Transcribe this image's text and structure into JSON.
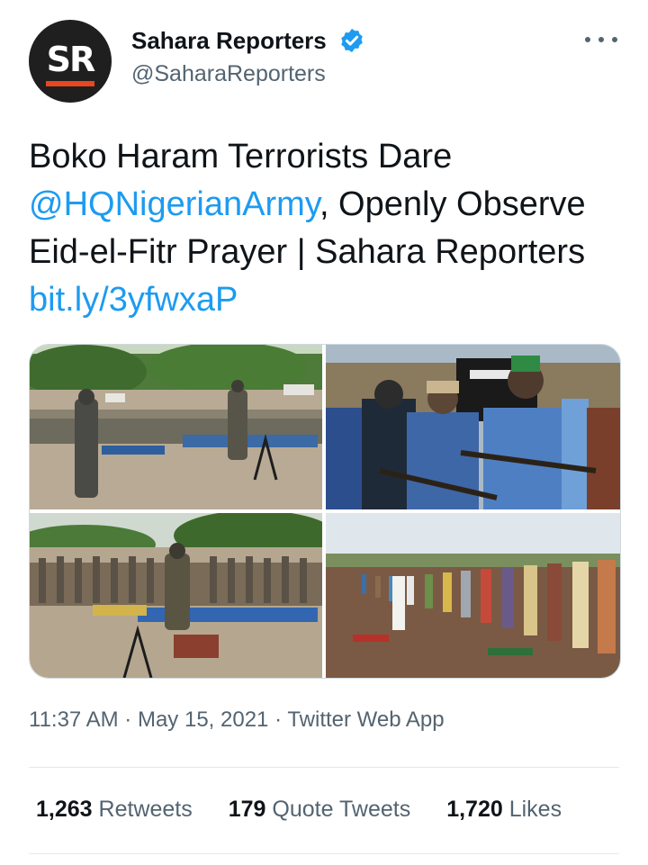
{
  "account": {
    "name": "Sahara Reporters",
    "handle": "@SaharaReporters",
    "avatar_text": "SR",
    "verified": true
  },
  "icons": {
    "verified": "verified-badge-icon",
    "more": "more-options-icon"
  },
  "tweet": {
    "text_part1": "Boko Haram Terrorists Dare ",
    "mention": "@HQNigerianArmy",
    "text_part2": ", Openly Observe Eid-el-Fitr Prayer | Sahara Reporters ",
    "link": "bit.ly/3yfwxaP"
  },
  "media": {
    "count": 4,
    "images": [
      "photo-gathering-with-guards",
      "photo-armed-men-with-flag",
      "photo-prayer-lines",
      "photo-prayer-rows-in-field"
    ]
  },
  "meta": {
    "time": "11:37 AM",
    "date": "May 15, 2021",
    "source": "Twitter Web App",
    "separator": "·"
  },
  "stats": {
    "retweets_count": "1,263",
    "retweets_label": "Retweets",
    "quotes_count": "179",
    "quotes_label": "Quote Tweets",
    "likes_count": "1,720",
    "likes_label": "Likes"
  },
  "colors": {
    "link": "#1d9bf0",
    "secondary_text": "#536471",
    "primary_text": "#0f1419",
    "avatar_bg": "#1f1f1f",
    "avatar_accent": "#e8461e"
  }
}
